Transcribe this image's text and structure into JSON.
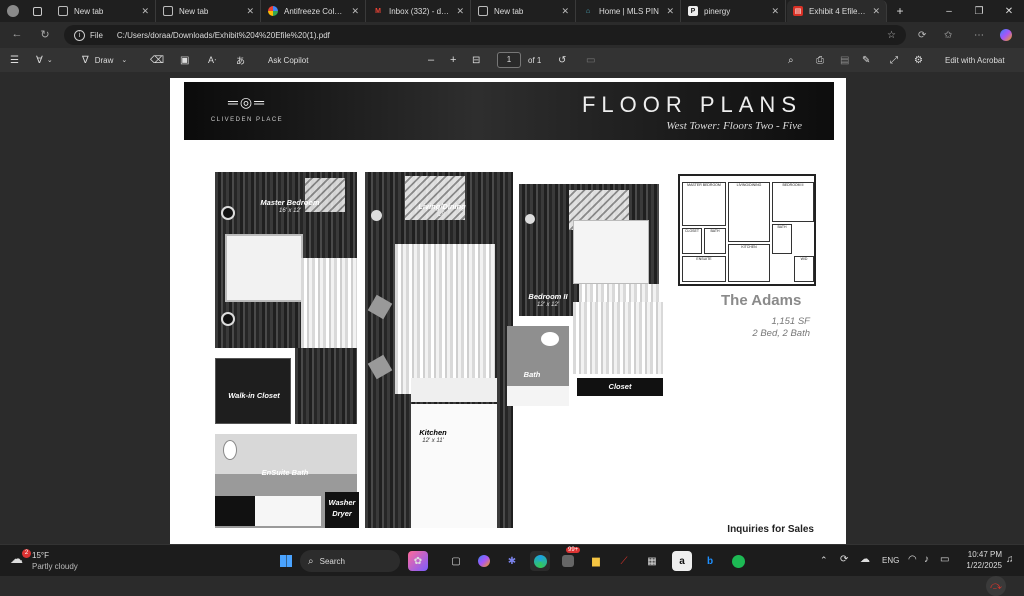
{
  "browser": {
    "tabs": [
      {
        "label": "New tab",
        "icon": "newtab-icon",
        "active": false
      },
      {
        "label": "New tab",
        "icon": "newtab-icon",
        "active": false
      },
      {
        "label": "Antifreeze Colors E",
        "icon": "google-icon",
        "active": false
      },
      {
        "label": "Inbox (332) - dora",
        "icon": "gmail-icon",
        "active": false
      },
      {
        "label": "New tab",
        "icon": "newtab-icon",
        "active": false
      },
      {
        "label": "Home | MLS PIN",
        "icon": "mls-icon",
        "active": false
      },
      {
        "label": "pinergy",
        "icon": "pinergy-icon",
        "active": false
      },
      {
        "label": "Exhibit 4 Efile (1).p",
        "icon": "pdf-icon",
        "active": true
      }
    ],
    "new_tab_symbol": "+",
    "window": {
      "minimize": "–",
      "maximize": "❐",
      "close": "✕"
    },
    "address": {
      "scheme_label": "File",
      "url": "C:/Users/doraa/Downloads/Exhibit%204%20Efile%20(1).pdf"
    }
  },
  "pdf_toolbar": {
    "draw_label": "Draw",
    "ask_label": "Ask Copilot",
    "minus": "–",
    "plus": "+",
    "page_current": "1",
    "page_total": "of 1",
    "edit_label": "Edit with Acrobat"
  },
  "document": {
    "logo_text": "CLIVEDEN PLACE",
    "title": "FLOOR PLANS",
    "subtitle": "West Tower:  Floors Two - Five",
    "rooms": {
      "master_bedroom": "Master Bedroom",
      "master_dim": "16' x 12'",
      "living_dining": "Living/Dining",
      "living_dim": "18'",
      "bedroom2": "Bedroom II",
      "bedroom2_dim": "12' x 12'",
      "bath": "Bath",
      "closet": "Closet",
      "walkin": "Walk-in Closet",
      "kitchen": "Kitchen",
      "kitchen_dim": "12' x 11'",
      "ensuite": "EnSuite Bath",
      "washer_dryer_1": "Washer",
      "washer_dryer_2": "Dryer"
    },
    "mini_plan": {
      "r1": "MASTER BEDROOM",
      "r2": "LIVING/DINING",
      "r3": "BEDROOM II",
      "r4": "CLOSET",
      "r5": "BATH",
      "r6": "KITCHEN",
      "r7": "ENSUITE",
      "r8": "BATH",
      "r9": "W/D"
    },
    "unit_name": "The Adams",
    "unit_sf": "1,151 SF",
    "unit_bb": "2 Bed, 2 Bath",
    "inquiries": "Inquiries for Sales"
  },
  "taskbar": {
    "weather_temp": "15°F",
    "weather_desc": "Partly cloudy",
    "search_label": "Search",
    "lang": "ENG",
    "time": "10:47 PM",
    "date": "1/22/2025",
    "badge": "99+",
    "notify_badge": "2"
  },
  "colors": {
    "accent": "#3b82f6",
    "pdf_red": "#e0332a",
    "spotify": "#1db954"
  }
}
